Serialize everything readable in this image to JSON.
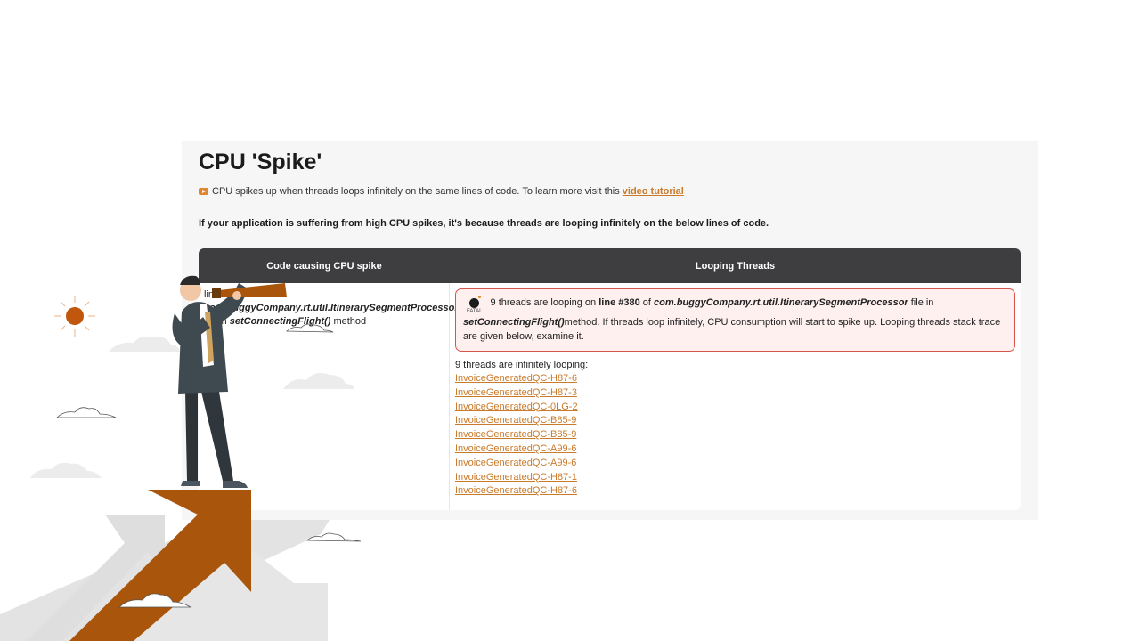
{
  "report": {
    "title": "CPU 'Spike'",
    "intro_text": "CPU spikes up when threads loops infinitely on the same lines of code. To learn more visit this",
    "intro_link": "video tutorial",
    "notice": "If your application is suffering from high CPU spikes, it's because threads are looping infinitely on the below lines of code."
  },
  "table": {
    "headers": {
      "code": "Code causing CPU spike",
      "threads": "Looping Threads"
    },
    "code_cell": {
      "prefix": "line #380 of",
      "class_name": "com.buggyCompany.rt.util.ItinerarySegmentProcessor",
      "mid": "file in",
      "method": "setConnectingFlight()",
      "suffix": "method"
    },
    "alert": {
      "icon": "bomb-icon",
      "badge": "FATAL",
      "count": "9",
      "text_1": "threads are looping on",
      "line": "line #380",
      "text_2": "of",
      "class_name": "com.buggyCompany.rt.util.ItinerarySegmentProcessor",
      "text_3": "file in",
      "method": "setConnectingFlight()",
      "text_4": "method. If threads loop infinitely, CPU consumption will start to spike up. Looping threads stack trace are given below, examine it."
    },
    "list_heading": "9 threads are infinitely looping:",
    "threads": [
      "InvoiceGeneratedQC-H87-6",
      "InvoiceGeneratedQC-H87-3",
      "InvoiceGeneratedQC-0LG-2",
      "InvoiceGeneratedQC-B85-9",
      "InvoiceGeneratedQC-B85-9",
      "InvoiceGeneratedQC-A99-6",
      "InvoiceGeneratedQC-A99-6",
      "InvoiceGeneratedQC-H87-1",
      "InvoiceGeneratedQC-H87-6"
    ]
  },
  "colors": {
    "accent": "#c97a2a",
    "header_bg": "#3e3d40",
    "alert_border": "#d9534f",
    "arrow_brown": "#a9550b",
    "sun": "#c0570c"
  }
}
